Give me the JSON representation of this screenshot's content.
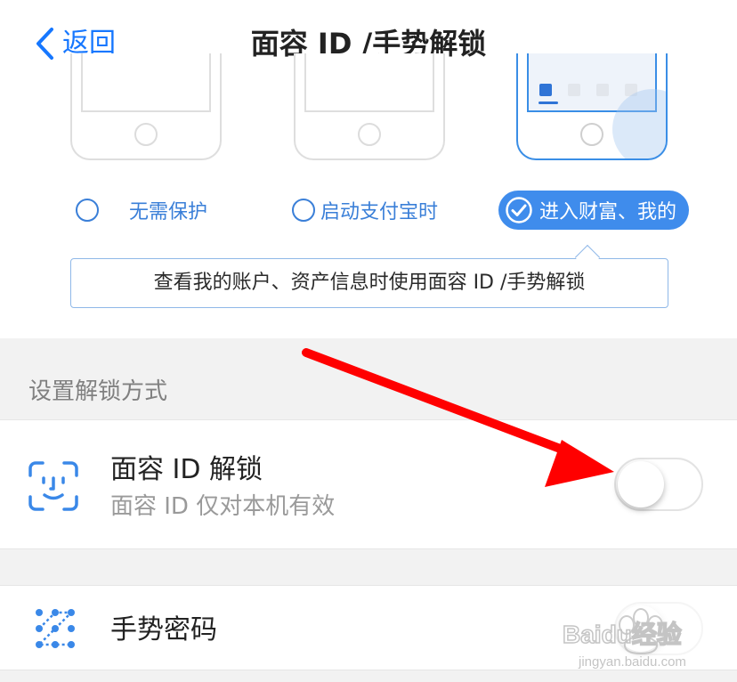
{
  "header": {
    "back_label": "返回",
    "title": "面容 ID /手势解锁"
  },
  "options": [
    {
      "label": "无需保护",
      "selected": false
    },
    {
      "label": "启动支付宝时",
      "selected": false
    },
    {
      "label": "进入财富、我的",
      "selected": true
    }
  ],
  "callout": {
    "text": "查看我的账户、资产信息时使用面容 ID /手势解锁"
  },
  "unlock_section": {
    "header": "设置解锁方式",
    "face_id": {
      "title": "面容 ID 解锁",
      "subtitle": "面容 ID 仅对本机有效",
      "enabled": false
    },
    "gesture": {
      "title": "手势密码",
      "enabled": false
    }
  },
  "watermark": {
    "brand": "Baidu经验",
    "url": "jingyan.baidu.com"
  },
  "colors": {
    "accent": "#3f8cec",
    "link": "#1677ff",
    "annotation_arrow": "#ff0000",
    "section_bg": "#f2f2f2"
  },
  "icons": {
    "back": "chevron-left-icon",
    "check": "checkmark-circle-icon",
    "face_id": "face-id-icon",
    "gesture": "gesture-grid-icon",
    "annotation": "red-arrow-icon"
  }
}
